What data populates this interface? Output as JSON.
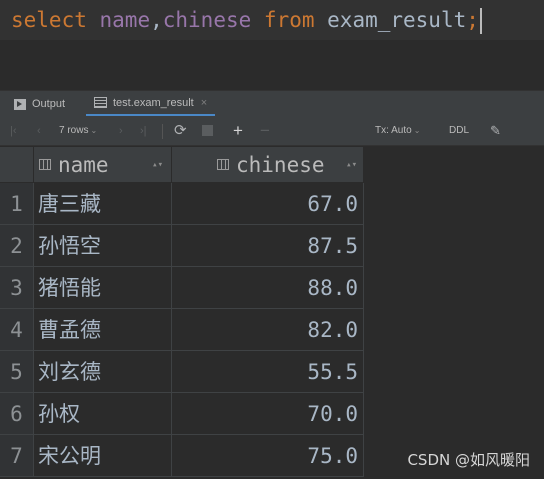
{
  "editor": {
    "tokens": {
      "select": "select",
      "space": " ",
      "col1": "name",
      "comma": ",",
      "col2": "chinese",
      "from": "from",
      "table": "exam_result",
      "semicolon": ";"
    }
  },
  "tabs": {
    "output_label": "Output",
    "result_label": "test.exam_result",
    "close_glyph": "×"
  },
  "toolbar": {
    "first_icon": "first-page-icon",
    "prev_icon": "previous-page-icon",
    "rows_label": "7 rows",
    "next_icon": "next-page-icon",
    "last_icon": "last-page-icon",
    "refresh_icon": "refresh-icon",
    "stop_icon": "stop-icon",
    "add_icon": "add-row-icon",
    "remove_icon": "remove-row-icon",
    "tx_label": "Tx: Auto",
    "ddl_label": "DDL",
    "pin_icon": "pin-icon"
  },
  "grid": {
    "columns": [
      "name",
      "chinese"
    ],
    "rows": [
      {
        "num": "1",
        "name": "唐三藏",
        "chinese": "67.0"
      },
      {
        "num": "2",
        "name": "孙悟空",
        "chinese": "87.5"
      },
      {
        "num": "3",
        "name": "猪悟能",
        "chinese": "88.0"
      },
      {
        "num": "4",
        "name": "曹孟德",
        "chinese": "82.0"
      },
      {
        "num": "5",
        "name": "刘玄德",
        "chinese": "55.5"
      },
      {
        "num": "6",
        "name": "孙权",
        "chinese": "70.0"
      },
      {
        "num": "7",
        "name": "宋公明",
        "chinese": "75.0"
      }
    ]
  },
  "watermark": "CSDN @如风暖阳",
  "colors": {
    "keyword": "#cc7832",
    "column": "#9876aa",
    "text": "#a9b7c6",
    "background": "#2b2b2b",
    "panel": "#3c3f41",
    "tab_underline": "#4a88c7"
  }
}
